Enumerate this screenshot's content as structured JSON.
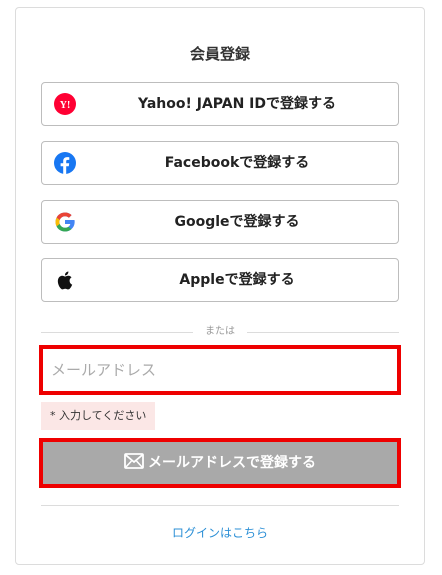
{
  "title": "会員登録",
  "sns_buttons": [
    {
      "label": "Yahoo! JAPAN IDで登録する",
      "icon": "yahoo-japan-icon"
    },
    {
      "label": "Facebookで登録する",
      "icon": "facebook-icon"
    },
    {
      "label": "Googleで登録する",
      "icon": "google-icon"
    },
    {
      "label": "Appleで登録する",
      "icon": "apple-icon"
    }
  ],
  "divider_text": "または",
  "email": {
    "value": "",
    "placeholder": "メールアドレス",
    "error": "* 入力してください"
  },
  "submit": {
    "label": "メールアドレスで登録する",
    "icon": "mail-icon"
  },
  "login_link": "ログインはこちら",
  "colors": {
    "highlight_border": "#ee0000",
    "submit_bg": "#a9a9a9",
    "error_bg": "#fbe7e6",
    "link": "#2b8fd6",
    "yahoo_red": "#ff0033",
    "facebook_blue": "#1877f2"
  }
}
